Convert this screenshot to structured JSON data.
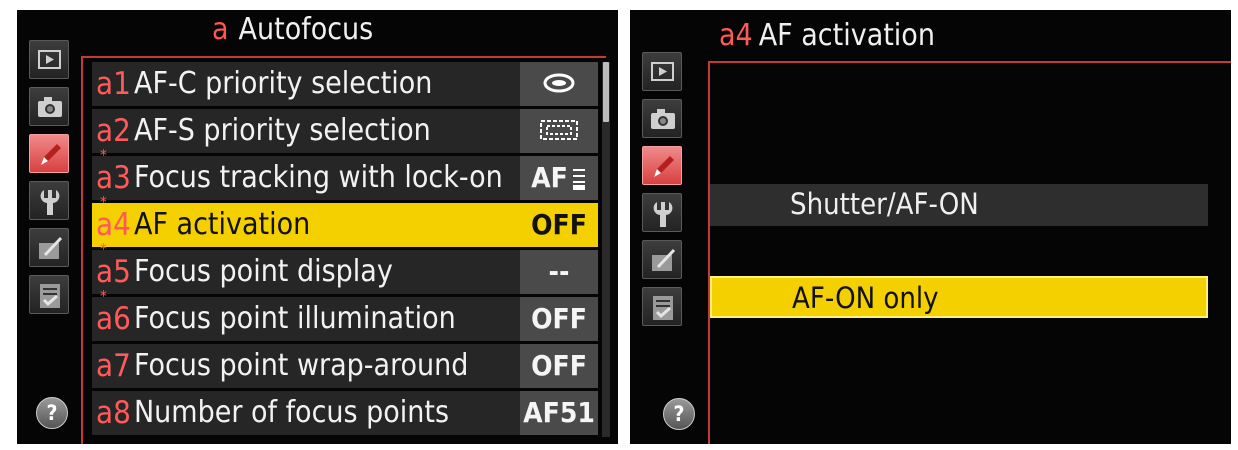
{
  "left": {
    "title_letter": "a",
    "title": "Autofocus",
    "items": [
      {
        "code": "a",
        "num": "1",
        "starred": false,
        "label": "AF-C priority selection",
        "value": "",
        "value_icon": "release-priority-icon",
        "selected": false
      },
      {
        "code": "a",
        "num": "2",
        "starred": false,
        "label": "AF-S priority selection",
        "value": "",
        "value_icon": "focus-priority-icon",
        "selected": false
      },
      {
        "code": "a",
        "num": "3",
        "starred": true,
        "label": "Focus tracking with lock-on",
        "value": "AF",
        "value_icon": "lock-on-scale-icon",
        "selected": false
      },
      {
        "code": "a",
        "num": "4",
        "starred": true,
        "label": "AF activation",
        "value": "OFF",
        "value_icon": "",
        "selected": true
      },
      {
        "code": "a",
        "num": "5",
        "starred": true,
        "label": "Focus point display",
        "value": "--",
        "value_icon": "",
        "selected": false
      },
      {
        "code": "a",
        "num": "6",
        "starred": true,
        "label": "Focus point illumination",
        "value": "OFF",
        "value_icon": "",
        "selected": false
      },
      {
        "code": "a",
        "num": "7",
        "starred": false,
        "label": "Focus point wrap-around",
        "value": "OFF",
        "value_icon": "",
        "selected": false
      },
      {
        "code": "a",
        "num": "8",
        "starred": false,
        "label": "Number of focus points",
        "value": "AF51",
        "value_icon": "",
        "selected": false
      }
    ],
    "star": "*"
  },
  "right": {
    "code": "a4",
    "title": "AF activation",
    "options": [
      {
        "label": "Shutter/AF-ON",
        "selected": false
      },
      {
        "label": "AF-ON only",
        "selected": true
      }
    ]
  },
  "sidebar": {
    "tabs": [
      "playback-icon",
      "camera-icon",
      "pencil-icon",
      "wrench-icon",
      "retouch-icon",
      "my-menu-icon"
    ],
    "active_index": 2,
    "help_label": "?"
  },
  "colors": {
    "accent_red": "#ff5a5a",
    "highlight_yellow": "#f5d000",
    "row_gray": "#262626",
    "value_gray": "#4a4a4a"
  }
}
